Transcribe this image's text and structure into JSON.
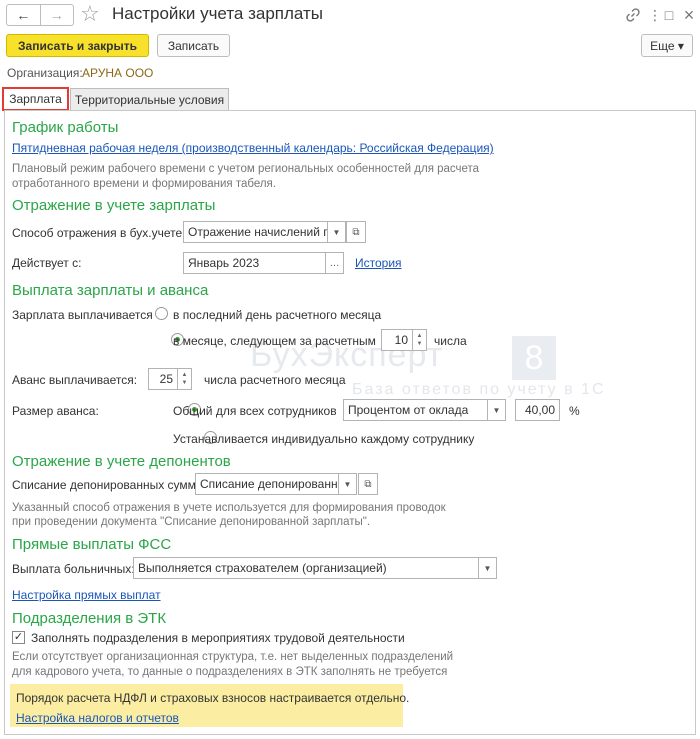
{
  "window": {
    "title": "Настройки учета зарплаты",
    "back_glyph": "←",
    "forward_glyph": "→",
    "star_glyph": "☆",
    "link_glyph": "🔗",
    "menu_glyph": "⋮",
    "minimize_glyph": "□",
    "close_glyph": "×"
  },
  "toolbar": {
    "save_close_label": "Записать и закрыть",
    "save_label": "Записать",
    "more_label": "Еще ▾"
  },
  "org": {
    "label": "Организация:",
    "value": "АРУНА ООО"
  },
  "tabs": [
    {
      "label": "Зарплата",
      "active": true
    },
    {
      "label": "Территориальные условия",
      "active": false
    }
  ],
  "work_schedule": {
    "heading": "График работы",
    "link": "Пятидневная рабочая неделя (производственный календарь: Российская Федерация)",
    "note_line1": "Плановый режим рабочего времени с учетом региональных особенностей для расчета",
    "note_line2": "отработанного времени и формирования табеля."
  },
  "accounting": {
    "heading": "Отражение в учете зарплаты",
    "method_label": "Способ отражения в бух.учете:",
    "method_value": "Отражение начислений по",
    "effective_label": "Действует с:",
    "effective_value": "Январь 2023",
    "history_link": "История"
  },
  "payment": {
    "heading": "Выплата зарплаты и аванса",
    "salary_label": "Зарплата выплачивается",
    "option_last_day": "в последний день расчетного месяца",
    "option_next_month": "в месяце, следующем за расчетным",
    "day_value": "10",
    "day_suffix": "числа",
    "advance_label": "Аванс выплачивается:",
    "advance_day": "25",
    "advance_suffix": "числа расчетного месяца",
    "size_label": "Размер аванса:",
    "option_common": "Общий для всех сотрудников",
    "size_method": "Процентом от оклада",
    "percent_value": "40,00",
    "percent_sign": "%",
    "option_individual": "Устанавливается индивидуально каждому сотруднику"
  },
  "deponents": {
    "heading": "Отражение в учете депонентов",
    "write_off_label": "Списание депонированных сумм:",
    "write_off_value": "Списание депонированно",
    "note_line1": "Указанный способ отражения в учете используется для формирования проводок",
    "note_line2": "при проведении документа \"Списание депонированной зарплаты\"."
  },
  "fss": {
    "heading": "Прямые выплаты ФСС",
    "sick_label": "Выплата больничных:",
    "sick_value": "Выполняется страхователем (организацией)",
    "settings_link": "Настройка прямых выплат"
  },
  "etk": {
    "heading": "Подразделения в ЭТК",
    "checkbox_label": "Заполнять подразделения в мероприятиях трудовой деятельности",
    "checked": true,
    "note_line1": "Если отсутствует организационная структура, т.е. нет выделенных подразделений",
    "note_line2": "для кадрового учета, то данные о подразделениях в ЭТК заполнять не требуется"
  },
  "hint": {
    "text": "Порядок расчета НДФЛ и страховых взносов настраивается отдельно.",
    "link": "Настройка налогов и отчетов"
  },
  "watermark": {
    "brand": "БухЭксперт",
    "digit": "8",
    "tagline": "База ответов по учету в 1С"
  },
  "colors": {
    "section_heading": "#2aa648",
    "link": "#1a56b8",
    "primary_button": "#f7e12a",
    "hint_background": "#fbeea3",
    "active_tab_border": "#e53935"
  }
}
